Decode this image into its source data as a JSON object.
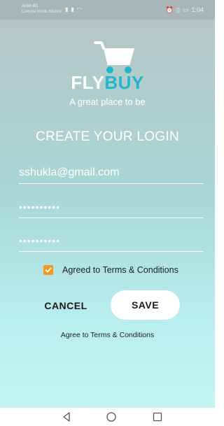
{
  "status_bar": {
    "carrier_line1": "Airtel 4G",
    "carrier_line2": "Cellone BSNL Mobile",
    "signal_icons": [
      "signal-icon",
      "signal-icon",
      "wifi-icon"
    ],
    "status_icons": [
      "alarm-icon",
      "vibrate-icon",
      "battery-icon"
    ],
    "time": "1:04"
  },
  "logo": {
    "icon": "shopping-cart-icon",
    "brand_part1": "FLY",
    "brand_part2": "BUY",
    "tagline": "A great place to be"
  },
  "form": {
    "title": "CREATE YOUR LOGIN",
    "email_value": "sshukla@gmail.com",
    "password_value": "••••••••••",
    "confirm_password_value": "••••••••••",
    "terms_checked": true,
    "terms_label": "Agreed to Terms & Conditions",
    "cancel_label": "CANCEL",
    "save_label": "SAVE",
    "bottom_terms": "Agree to Terms & Conditions"
  },
  "nav_bar": {
    "buttons": [
      "back-icon",
      "home-icon",
      "recent-apps-icon"
    ]
  },
  "colors": {
    "accent_blue": "#21b8cf",
    "checkbox_orange": "#f29a1f",
    "background_top": "#b8c4c4",
    "background_bottom": "#c9f6f6"
  }
}
